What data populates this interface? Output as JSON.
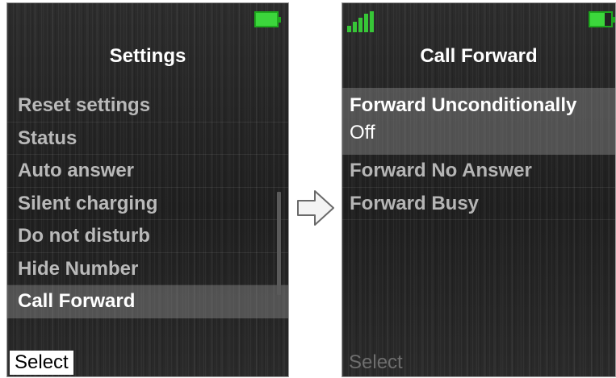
{
  "left_screen": {
    "title": "Settings",
    "menu_items": [
      "Reset settings",
      "Status",
      "Auto answer",
      "Silent charging",
      "Do not disturb",
      "Hide Number",
      "Call Forward"
    ],
    "selected_item": "Call Forward",
    "softkey_label": "Select"
  },
  "right_screen": {
    "title": "Call Forward",
    "items": [
      {
        "label": "Forward Unconditionally",
        "value": "Off"
      },
      {
        "label": "Forward No Answer"
      },
      {
        "label": "Forward Busy"
      }
    ],
    "softkey_label": "Select"
  },
  "colors": {
    "battery_green": "#3cd63c",
    "signal_green": "#37c637",
    "selection_highlight": "#8c8c8c"
  },
  "icons": {
    "battery": "battery-icon",
    "signal": "signal-strength-icon",
    "arrow": "right-arrow-icon"
  }
}
